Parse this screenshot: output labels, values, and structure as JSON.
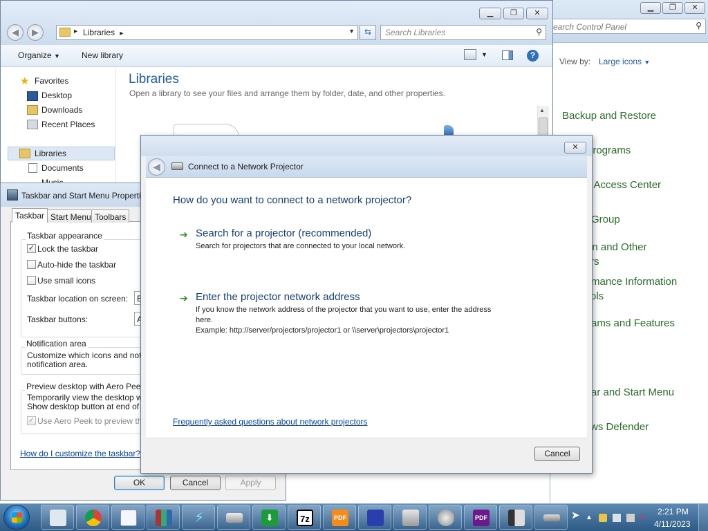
{
  "control_panel": {
    "search_placeholder": "Search Control Panel",
    "view_by_label": "View by:",
    "view_by_value": "Large icons",
    "items": [
      {
        "label": "Backup and Restore"
      },
      {
        "label": "t Programs"
      },
      {
        "label": "f Access Center"
      },
      {
        "label": "Group"
      },
      {
        "label": "on and Other"
      },
      {
        "label": "rs"
      },
      {
        "label": "mance Information"
      },
      {
        "label": "ols"
      },
      {
        "label": "ams and Features"
      },
      {
        "label": "ar and Start Menu"
      },
      {
        "label": "ws Defender"
      }
    ]
  },
  "explorer": {
    "breadcrumb": "Libraries",
    "search_placeholder": "Search Libraries",
    "toolbar": {
      "organize": "Organize",
      "new_library": "New library",
      "help": "?"
    },
    "nav": {
      "favorites": "Favorites",
      "desktop": "Desktop",
      "downloads": "Downloads",
      "recent": "Recent Places",
      "libraries": "Libraries",
      "documents": "Documents",
      "music": "Music"
    },
    "title": "Libraries",
    "subtitle": "Open a library to see your files and arrange them by folder, date, and other properties."
  },
  "taskbar_props": {
    "title": "Taskbar and Start Menu Properties",
    "tabs": [
      "Taskbar",
      "Start Menu",
      "Toolbars"
    ],
    "appearance_label": "Taskbar appearance",
    "lock_label": "Lock the taskbar",
    "autohide_label": "Auto-hide the taskbar",
    "small_icons_label": "Use small icons",
    "location_label": "Taskbar location on screen:",
    "location_value": "B",
    "buttons_label": "Taskbar buttons:",
    "buttons_value": "A",
    "notification_label": "Notification area",
    "notification_text1": "Customize which icons and notifica",
    "notification_text2": "notification area.",
    "peek_label": "Preview desktop with Aero Peek",
    "peek_text1": "Temporarily view the desktop wher",
    "peek_text2": "Show desktop button at end of the",
    "peek_check_label": "Use Aero Peek to preview the c",
    "help_link": "How do I customize the taskbar?",
    "ok": "OK",
    "cancel": "Cancel",
    "apply": "Apply"
  },
  "projector": {
    "title": "Connect to a Network Projector",
    "question": "How do you want to connect to a network projector?",
    "opt1_title": "Search for a projector (recommended)",
    "opt1_desc": "Search for projectors that are connected to your local network.",
    "opt2_title": "Enter the projector network address",
    "opt2_desc1": "If you know the network address of the projector that you want to use, enter the address",
    "opt2_desc2": "here.",
    "opt2_desc3": "Example: http://server/projectors/projector1 or \\\\server\\projectors\\projector1",
    "faq_link": "Frequently asked questions about network projectors",
    "cancel": "Cancel"
  },
  "taskbar": {
    "apps": [
      {
        "icon": "notepad-icon"
      },
      {
        "icon": "chrome-icon"
      },
      {
        "icon": "wordpad-icon"
      },
      {
        "icon": "winrar-icon"
      },
      {
        "icon": "lightning-icon"
      },
      {
        "icon": "projector-icon"
      },
      {
        "icon": "download-icon",
        "text": "⬇"
      },
      {
        "icon": "7zip-icon",
        "text": "7z"
      },
      {
        "icon": "pdf-icon",
        "text": "PDF"
      },
      {
        "icon": "floppy-icon"
      },
      {
        "icon": "fax-icon"
      },
      {
        "icon": "speaker-icon"
      },
      {
        "icon": "pdf-editor-icon",
        "text": "PDF"
      },
      {
        "icon": "server-icon"
      },
      {
        "icon": "keyboard-icon"
      }
    ],
    "time": "2:21 PM",
    "date": "4/11/2023"
  }
}
